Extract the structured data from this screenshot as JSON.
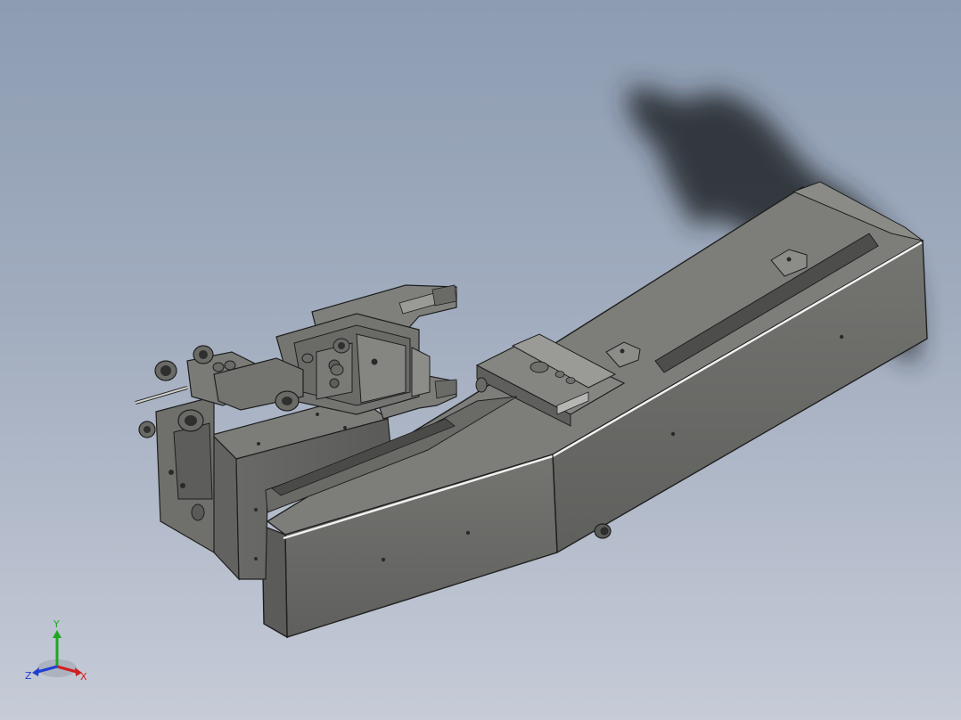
{
  "viewport": {
    "background_top": "#8d9cb2",
    "background_bottom": "#c6cbd7",
    "model": {
      "body_color": "#6d6e6b",
      "top_face_color": "#7b7c78",
      "edge_color": "#1f1f1f",
      "highlight_color": "#f2f2f2",
      "shadow_color": "#2a2c30"
    }
  },
  "triad": {
    "x_label": "X",
    "y_label": "Y",
    "z_label": "Z",
    "x_color": "#d21e1e",
    "y_color": "#1fa81f",
    "z_color": "#1e3fd2"
  }
}
